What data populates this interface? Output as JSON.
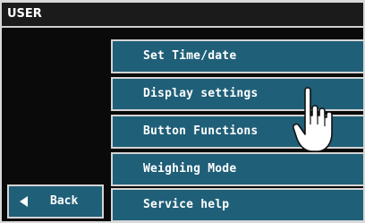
{
  "window": {
    "title": "USER"
  },
  "menu": {
    "items": [
      {
        "label": "Set Time/date"
      },
      {
        "label": "Display settings"
      },
      {
        "label": "Button Functions"
      },
      {
        "label": "Weighing Mode"
      },
      {
        "label": "Service help"
      }
    ]
  },
  "back_button": {
    "label": "Back",
    "icon": "left-arrow-icon"
  },
  "pointer": {
    "icon": "hand-pointer-icon"
  },
  "colors": {
    "button_fill": "#1f5f78",
    "button_border": "#d4d4d4",
    "screen_background": "#0a0a0a",
    "text": "#ffffff"
  }
}
